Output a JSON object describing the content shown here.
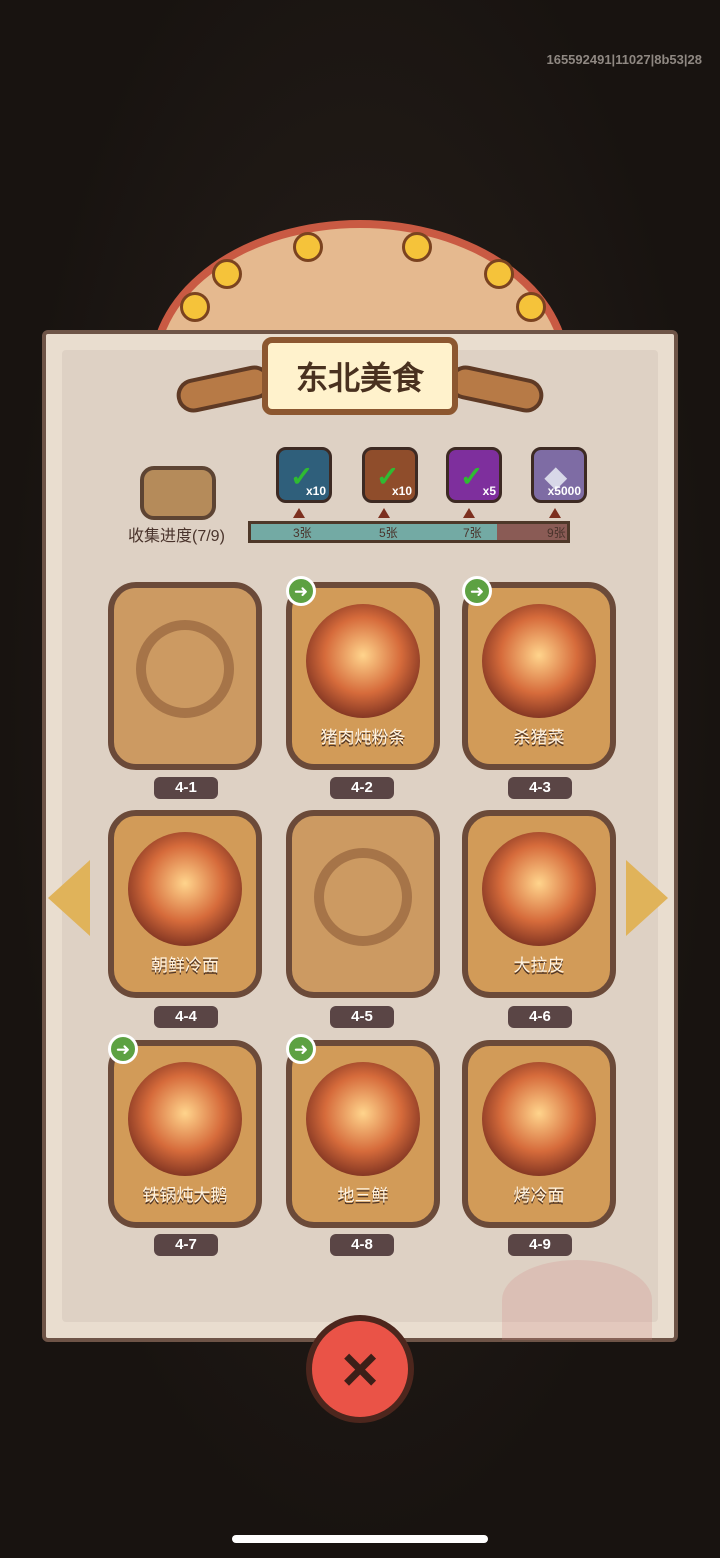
{
  "status": {
    "debug_id": "165592491|11027|8b53|28"
  },
  "panel": {
    "title": "东北美食",
    "collection_label": "收集进度(7/9)"
  },
  "rewards": [
    {
      "qty": "x10",
      "color": "#2f5f7b"
    },
    {
      "qty": "x10",
      "color": "#8f4d2b"
    },
    {
      "qty": "x5",
      "color": "#7e2f9d"
    },
    {
      "qty": "x5000",
      "color": "#7e6ca4"
    }
  ],
  "progress": {
    "current": 7,
    "total": 9,
    "milestones": [
      "3张",
      "5张",
      "7张",
      "9张"
    ]
  },
  "cards": [
    {
      "id": "4-1",
      "name": "",
      "locked": true,
      "shared": false
    },
    {
      "id": "4-2",
      "name": "猪肉炖粉条",
      "locked": false,
      "shared": true
    },
    {
      "id": "4-3",
      "name": "杀猪菜",
      "locked": false,
      "shared": true
    },
    {
      "id": "4-4",
      "name": "朝鲜冷面",
      "locked": false,
      "shared": false
    },
    {
      "id": "4-5",
      "name": "",
      "locked": true,
      "shared": false
    },
    {
      "id": "4-6",
      "name": "大拉皮",
      "locked": false,
      "shared": false
    },
    {
      "id": "4-7",
      "name": "铁锅炖大鹅",
      "locked": false,
      "shared": true
    },
    {
      "id": "4-8",
      "name": "地三鲜",
      "locked": false,
      "shared": true
    },
    {
      "id": "4-9",
      "name": "烤冷面",
      "locked": false,
      "shared": false
    }
  ],
  "icons": {
    "left": "left-arrow-icon",
    "right": "right-arrow-icon",
    "close": "close-icon",
    "share": "share-icon"
  }
}
